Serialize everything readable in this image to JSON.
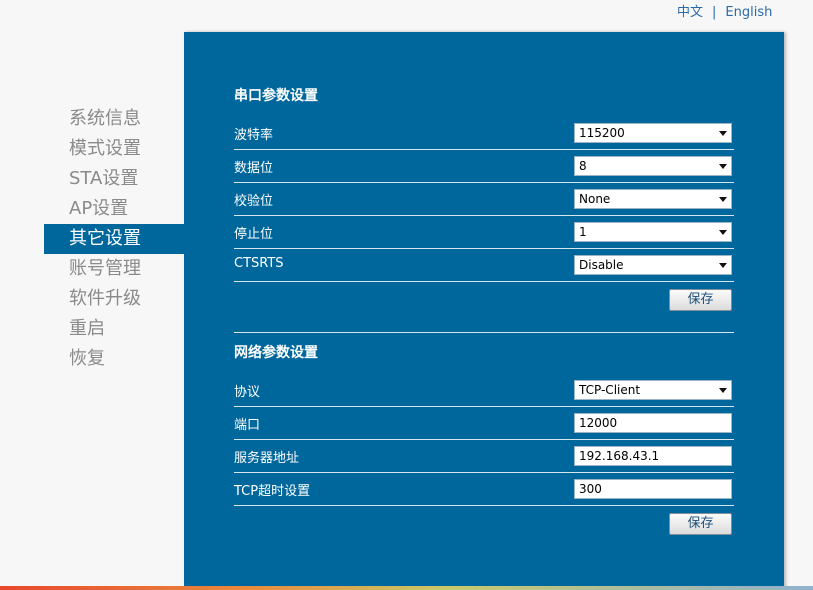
{
  "language": {
    "chinese": "中文",
    "separator": "|",
    "english": "English"
  },
  "nav": {
    "items": [
      {
        "label": "系统信息"
      },
      {
        "label": "模式设置"
      },
      {
        "label": "STA设置"
      },
      {
        "label": "AP设置"
      },
      {
        "label": "其它设置"
      },
      {
        "label": "账号管理"
      },
      {
        "label": "软件升级"
      },
      {
        "label": "重启"
      },
      {
        "label": "恢复"
      }
    ],
    "active": "其它设置"
  },
  "serial": {
    "title": "串口参数设置",
    "baud_rate": {
      "label": "波特率",
      "value": "115200"
    },
    "data_bits": {
      "label": "数据位",
      "value": "8"
    },
    "parity": {
      "label": "校验位",
      "value": "None"
    },
    "stop_bits": {
      "label": "停止位",
      "value": "1"
    },
    "ctsrts": {
      "label": "CTSRTS",
      "value": "Disable"
    },
    "save_label": "保存"
  },
  "network": {
    "title": "网络参数设置",
    "protocol": {
      "label": "协议",
      "value": "TCP-Client"
    },
    "port": {
      "label": "端口",
      "value": "12000"
    },
    "server_address": {
      "label": "服务器地址",
      "value": "192.168.43.1"
    },
    "tcp_timeout": {
      "label": "TCP超时设置",
      "value": "300"
    },
    "save_label": "保存"
  },
  "colors": {
    "panel": "#00679c",
    "nav_active": "#00679c",
    "nav_text": "#8a8a8a",
    "link": "#2a6aa8"
  }
}
